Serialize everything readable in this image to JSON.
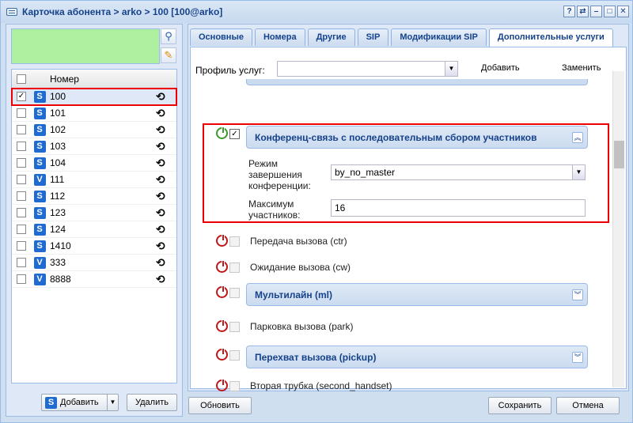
{
  "window": {
    "title": "Карточка абонента > arko > 100 [100@arko]",
    "controls": [
      "?",
      "⇄",
      "–",
      "□",
      "✕"
    ]
  },
  "left": {
    "grid_header": "Номер",
    "rows": [
      {
        "number": "100",
        "type": "S",
        "checked": true
      },
      {
        "number": "101",
        "type": "S",
        "checked": false
      },
      {
        "number": "102",
        "type": "S",
        "checked": false
      },
      {
        "number": "103",
        "type": "S",
        "checked": false
      },
      {
        "number": "104",
        "type": "S",
        "checked": false
      },
      {
        "number": "111",
        "type": "V",
        "checked": false
      },
      {
        "number": "112",
        "type": "S",
        "checked": false
      },
      {
        "number": "123",
        "type": "S",
        "checked": false
      },
      {
        "number": "124",
        "type": "S",
        "checked": false
      },
      {
        "number": "1410",
        "type": "S",
        "checked": false
      },
      {
        "number": "333",
        "type": "V",
        "checked": false
      },
      {
        "number": "8888",
        "type": "V",
        "checked": false
      }
    ],
    "add_label": "Добавить",
    "delete_label": "Удалить"
  },
  "tabs": [
    "Основные",
    "Номера",
    "Другие",
    "SIP",
    "Модификации SIP",
    "Дополнительные услуги"
  ],
  "profile": {
    "label": "Профиль услуг:",
    "value": "",
    "add": "Добавить",
    "replace": "Заменить"
  },
  "conf": {
    "title": "Конференц-связь с последовательным сбором участников (cc",
    "mode_label": "Режим завершения конференции:",
    "mode_value": "by_no_master",
    "max_label": "Максимум участников:",
    "max_value": "16"
  },
  "services": [
    {
      "label": "Передача вызова (ctr)",
      "group": false
    },
    {
      "label": "Ожидание вызова (cw)",
      "group": false
    },
    {
      "label": "Мультилайн (ml)",
      "group": true
    },
    {
      "label": "Парковка вызова (park)",
      "group": false
    },
    {
      "label": "Перехват вызова (pickup)",
      "group": true
    },
    {
      "label": "Вторая трубка (second_handset)",
      "group": false
    }
  ],
  "buttons": {
    "refresh": "Обновить",
    "save": "Сохранить",
    "cancel": "Отмена"
  }
}
